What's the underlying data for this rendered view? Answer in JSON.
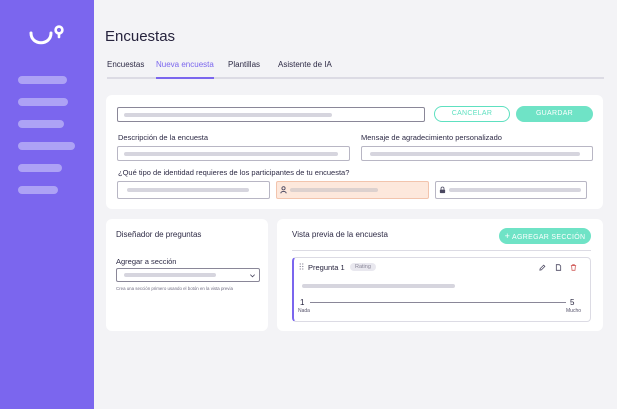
{
  "page": {
    "title": "Encuestas"
  },
  "tabs": [
    {
      "label": "Encuestas"
    },
    {
      "label": "Nueva encuesta"
    },
    {
      "label": "Plantillas"
    },
    {
      "label": "Asistente de IA"
    }
  ],
  "form": {
    "cancel_label": "CANCELAR",
    "save_label": "GUARDAR",
    "description_label": "Descripción de la encuesta",
    "thanks_label": "Mensaje de agradecimiento personalizado",
    "identity_label": "¿Qué tipo de identidad requieres de los participantes de tu encuesta?"
  },
  "designer": {
    "title": "Diseñador de preguntas",
    "add_to_section_label": "Agregar a sección",
    "helper_text": "Crea una sección primero usando el botón en la vista previa"
  },
  "preview": {
    "title": "Vista previa de la encuesta",
    "add_section_label": "AGREGAR SECCIÓN",
    "question": {
      "label": "Pregunta 1",
      "type_badge": "Rating",
      "scale_min": "1",
      "scale_max": "5",
      "min_caption": "Nada",
      "max_caption": "Mucho"
    }
  },
  "colors": {
    "sidebar": "#7b66ee",
    "accent": "#7b66ee",
    "mint": "#6fe3c6",
    "identity_selected": "#fde8dc"
  },
  "icons": [
    "logo-icon",
    "person-icon",
    "lock-icon",
    "chevron-down-icon",
    "plus-icon",
    "drag-handle-icon",
    "edit-icon",
    "copy-icon",
    "trash-icon"
  ]
}
